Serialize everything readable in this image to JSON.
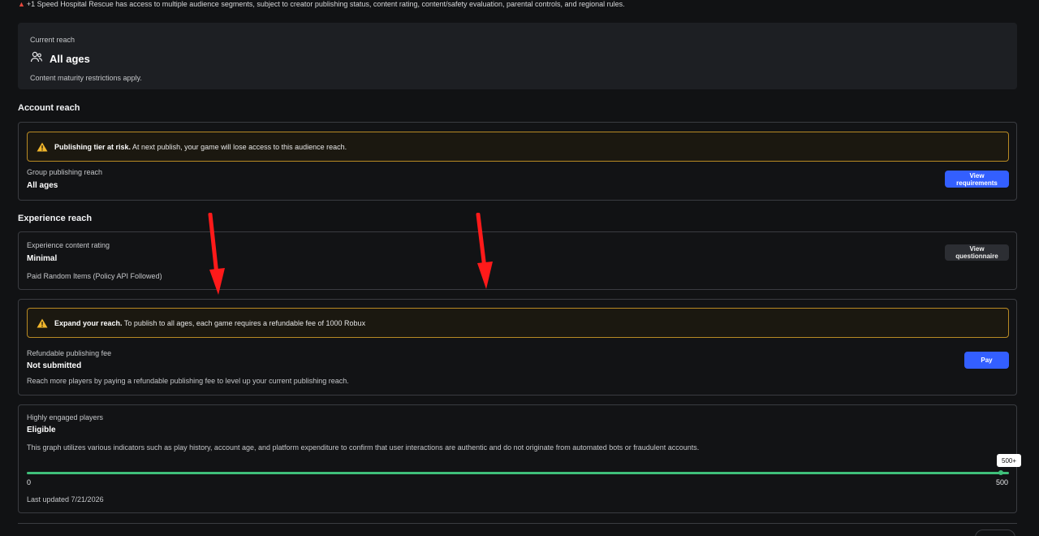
{
  "top_notice": {
    "text": "+1 Speed Hospital Rescue has access to multiple audience segments, subject to creator publishing status, content rating, content/safety evaluation, parental controls, and regional rules."
  },
  "current_reach": {
    "label": "Current reach",
    "value": "All ages",
    "note": "Content maturity restrictions apply.",
    "icon": "users-icon"
  },
  "account_reach": {
    "heading": "Account reach",
    "alert_title": "Publishing tier at risk.",
    "alert_text": " At next publish, your game will lose access to this audience reach.",
    "field_label": "Group publishing reach",
    "field_value": "All ages",
    "button_label": "View requirements"
  },
  "experience_reach": {
    "heading": "Experience reach",
    "rating_label": "Experience content rating",
    "rating_value": "Minimal",
    "rating_desc": "Paid Random Items (Policy API Followed)",
    "button_label": "View questionnaire"
  },
  "publishing_fee": {
    "alert_title": "Expand your reach.",
    "alert_text": " To publish to all ages, each game requires a refundable fee of 1000 Robux",
    "field_label": "Refundable publishing fee",
    "field_value": "Not submitted",
    "field_desc": "Reach more players by paying a refundable publishing fee to level up your current publishing reach.",
    "button_label": "Pay"
  },
  "engaged_players": {
    "label": "Highly engaged players",
    "value": "Eligible",
    "desc": "This graph utilizes various indicators such as play history, account age, and platform expenditure to confirm that user interactions are authentic and do not originate from automated bots or fraudulent accounts.",
    "progress_fraction": 1.0,
    "tooltip": "500+",
    "axis_min": "0",
    "axis_max": "500",
    "last_updated": "Last updated 7/21/2026"
  },
  "colors": {
    "accent_blue": "#335fff",
    "warning_border": "#b88a24",
    "success_green": "#3fbf7a",
    "annotation_red": "#ff1a1a"
  }
}
